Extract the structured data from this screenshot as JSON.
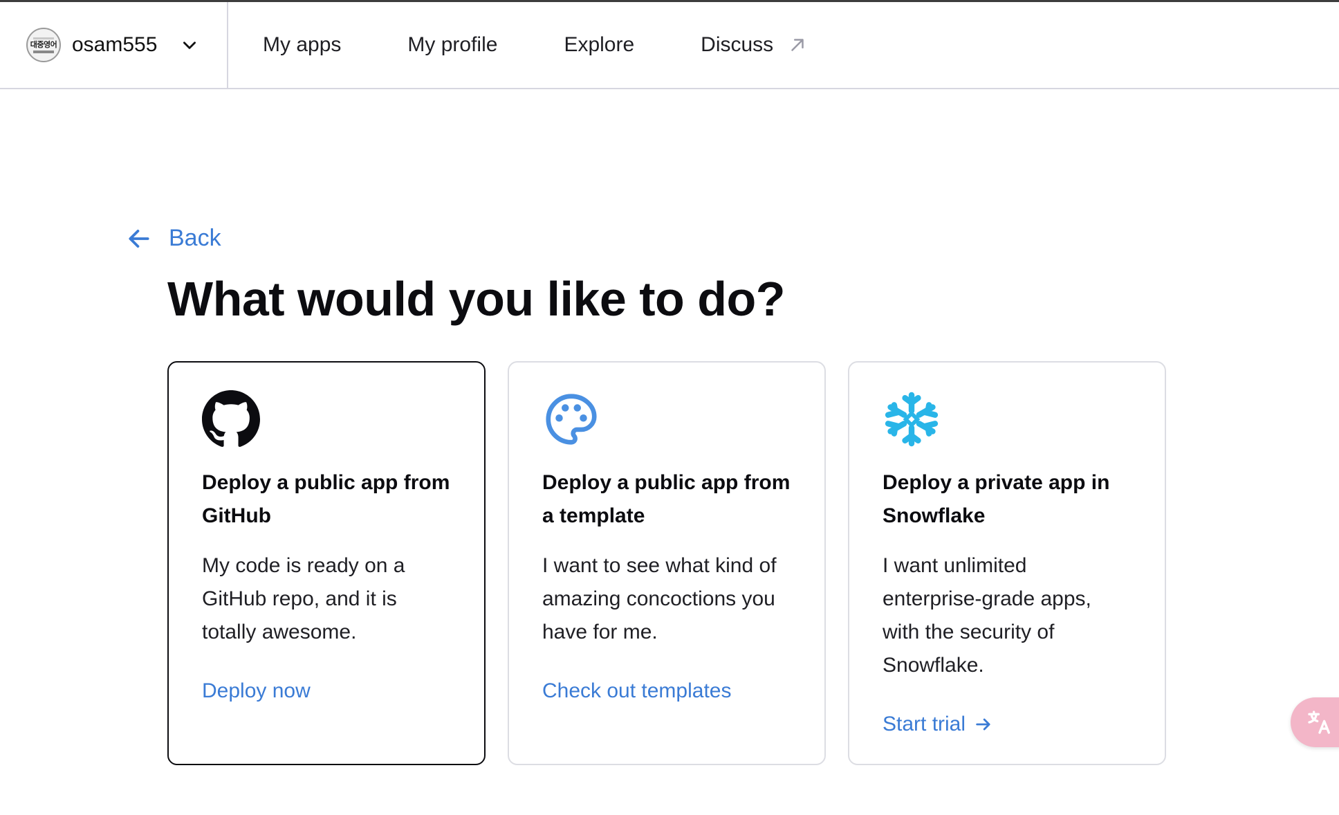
{
  "header": {
    "avatar_text": "대중영어",
    "username": "osam555",
    "nav": [
      {
        "label": "My apps"
      },
      {
        "label": "My profile"
      },
      {
        "label": "Explore"
      },
      {
        "label": "Discuss",
        "external": true
      }
    ]
  },
  "back_label": "Back",
  "page_title": "What would you like to do?",
  "cards": [
    {
      "icon": "github-icon",
      "heading": "Deploy a public app from GitHub",
      "description": "My code is ready on a GitHub repo, and it is totally awesome.",
      "link": "Deploy now",
      "selected": true
    },
    {
      "icon": "palette-icon",
      "heading": "Deploy a public app from a template",
      "description": "I want to see what kind of amazing concoctions you have for me.",
      "link": "Check out templates",
      "selected": false
    },
    {
      "icon": "snowflake-icon",
      "heading": "Deploy a private app in Snowflake",
      "description": "I want unlimited enterprise-grade apps, with the security of Snowflake.",
      "link": "Start trial",
      "selected": false
    }
  ],
  "colors": {
    "accent": "#3a7bd5",
    "snowflake": "#29b5e8",
    "palette": "#4a90e2",
    "translate_fab": "#f3b6c8"
  }
}
